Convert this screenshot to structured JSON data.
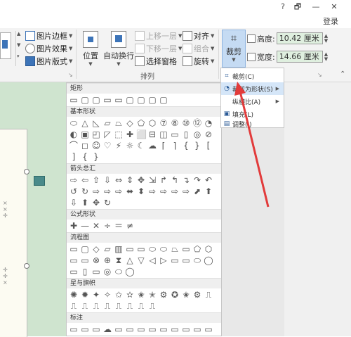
{
  "titlebar": {
    "help": "?",
    "restore": "🗗",
    "minimize": "—",
    "close": "✕",
    "login": "登录"
  },
  "ribbon": {
    "border_label": "图片边框",
    "effect_label": "图片效果",
    "layout_label": "图片版式",
    "position_label": "位置",
    "wrap_label": "自动换行",
    "bring_forward": "上移一层",
    "send_backward": "下移一层",
    "selection_pane": "选择窗格",
    "align": "对齐",
    "group": "组合",
    "rotate": "旋转",
    "arrange_group": "排列",
    "crop_label": "裁剪",
    "height_label": "高度:",
    "height_value": "10.42 厘米",
    "width_label": "宽度:",
    "width_value": "14.66 厘米"
  },
  "crop_menu": {
    "items": [
      {
        "label": "裁剪(C)",
        "icon": "crop-icon"
      },
      {
        "label": "裁剪为形状(S)",
        "icon": "shape-icon",
        "submenu": true
      },
      {
        "label": "纵横比(A)",
        "icon": "",
        "submenu": true
      },
      {
        "label": "填充(L)",
        "icon": "fill-icon"
      },
      {
        "label": "调整(I)",
        "icon": "fit-icon"
      }
    ]
  },
  "gallery": {
    "sections": [
      {
        "title": "矩形",
        "shapes": [
          "▭",
          "▢",
          "▢",
          "▭",
          "▭",
          "▢",
          "▢",
          "▢",
          "▢"
        ]
      },
      {
        "title": "基本形状",
        "shapes": [
          "⬭",
          "△",
          "◺",
          "▱",
          "⏢",
          "◇",
          "⬠",
          "⬡",
          "⑦",
          "⑧",
          "⑩",
          "⑫",
          "◔",
          "◐",
          "▣",
          "◰",
          "◸",
          "⬚",
          "✚",
          "⬜",
          "⊟",
          "◫",
          "▭",
          "▯",
          "◎",
          "⊘",
          "⌒",
          "◻",
          "☺",
          "♡",
          "⚡",
          "☼",
          "☾",
          "☁",
          "⌈",
          "⌉",
          "{",
          "}",
          "[",
          "]",
          "{",
          "}"
        ]
      },
      {
        "title": "箭头总汇",
        "shapes": [
          "⇨",
          "⇦",
          "⇧",
          "⇩",
          "⇔",
          "⇕",
          "✥",
          "⇲",
          "↱",
          "↰",
          "↴",
          "↷",
          "↶",
          "↺",
          "↻",
          "⇨",
          "⇨",
          "⇨",
          "⬌",
          "⬍",
          "⇨",
          "⇨",
          "⇨",
          "⇨",
          "⬈",
          "⬆",
          "⇩",
          "⬆",
          "✥",
          "↻"
        ]
      },
      {
        "title": "公式形状",
        "shapes": [
          "✚",
          "—",
          "✕",
          "÷",
          "＝",
          "≠"
        ]
      },
      {
        "title": "流程图",
        "shapes": [
          "▭",
          "▢",
          "◇",
          "▱",
          "▥",
          "▭",
          "▭",
          "⬭",
          "⬭",
          "⏢",
          "▭",
          "⬠",
          "⬡",
          "▭",
          "▭",
          "⊗",
          "⊕",
          "⧗",
          "△",
          "▽",
          "◁",
          "▷",
          "▭",
          "▭",
          "⬭",
          "◯",
          "▭",
          "▯",
          "▭",
          "◎",
          "⬭",
          "◯"
        ]
      },
      {
        "title": "星与旗帜",
        "shapes": [
          "✺",
          "✹",
          "✦",
          "✧",
          "✩",
          "✫",
          "✬",
          "✭",
          "⚙",
          "✪",
          "✬",
          "⚙",
          "⎍",
          "⎍",
          "⎍",
          "⎍",
          "⎍",
          "⎍",
          "⎍",
          "⎍",
          "⎍"
        ]
      },
      {
        "title": "标注",
        "shapes": [
          "▭",
          "▭",
          "▭",
          "☁",
          "▭",
          "▭",
          "▭",
          "▭",
          "▭",
          "▭",
          "▭",
          "▭",
          "▭"
        ]
      }
    ]
  },
  "doc": {
    "side_marks": [
      "×",
      "×",
      "✛",
      "✛",
      "✛",
      "×"
    ]
  }
}
